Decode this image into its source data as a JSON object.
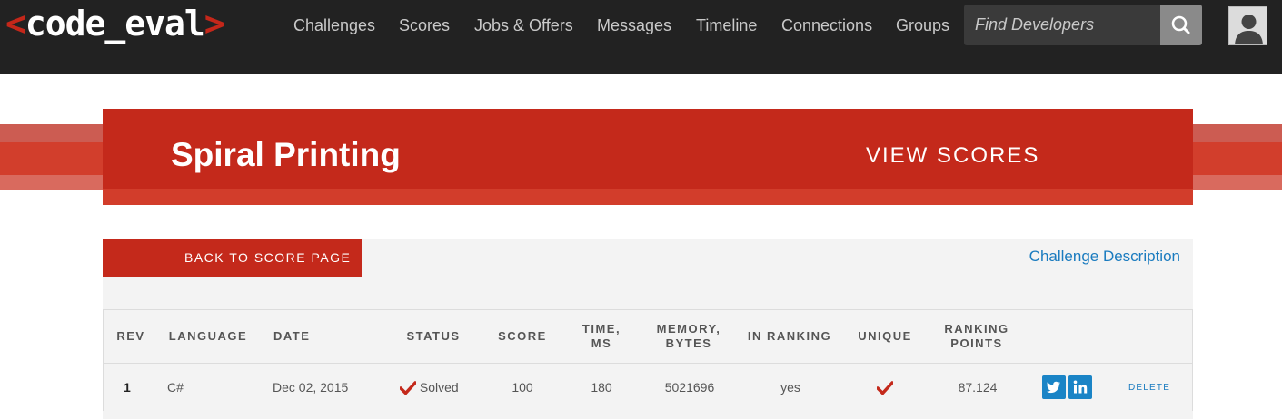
{
  "app": {
    "logo": {
      "open": "<",
      "text": "code_eval",
      "close": ">"
    }
  },
  "nav": {
    "items": [
      {
        "label": "Challenges"
      },
      {
        "label": "Scores"
      },
      {
        "label": "Jobs & Offers"
      },
      {
        "label": "Messages"
      },
      {
        "label": "Timeline"
      },
      {
        "label": "Connections"
      },
      {
        "label": "Groups"
      }
    ],
    "search": {
      "placeholder": "Find Developers",
      "icon": "search-icon"
    },
    "avatar_icon": "user-silhouette-icon"
  },
  "banner": {
    "title": "Spiral Printing",
    "view_scores": "VIEW SCORES"
  },
  "panel": {
    "back_label": "BACK TO SCORE PAGE",
    "challenge_description": "Challenge Description"
  },
  "table": {
    "headers": [
      {
        "label": "REV"
      },
      {
        "label": "LANGUAGE"
      },
      {
        "label": "DATE"
      },
      {
        "label": "STATUS"
      },
      {
        "label": "SCORE"
      },
      {
        "label": "TIME,\nMS"
      },
      {
        "label": "MEMORY,\nBYTES"
      },
      {
        "label": "IN RANKING"
      },
      {
        "label": "UNIQUE"
      },
      {
        "label": "RANKING\nPOINTS"
      }
    ],
    "rows": [
      {
        "rev": "1",
        "language": "C#",
        "date": "Dec 02, 2015",
        "status": "Solved",
        "score": "100",
        "time_ms": "180",
        "memory_bytes": "5021696",
        "in_ranking": "yes",
        "unique_icon": "checkmark-icon",
        "ranking_points": "87.124",
        "share_icons": [
          "twitter-icon",
          "linkedin-icon"
        ],
        "delete_label": "DELETE"
      }
    ]
  },
  "colors": {
    "topbar": "#222222",
    "brand_red": "#c4291b",
    "link_blue": "#1a7bbf",
    "social_blue": "#1a84c6",
    "panel_bg": "#f3f3f3"
  }
}
